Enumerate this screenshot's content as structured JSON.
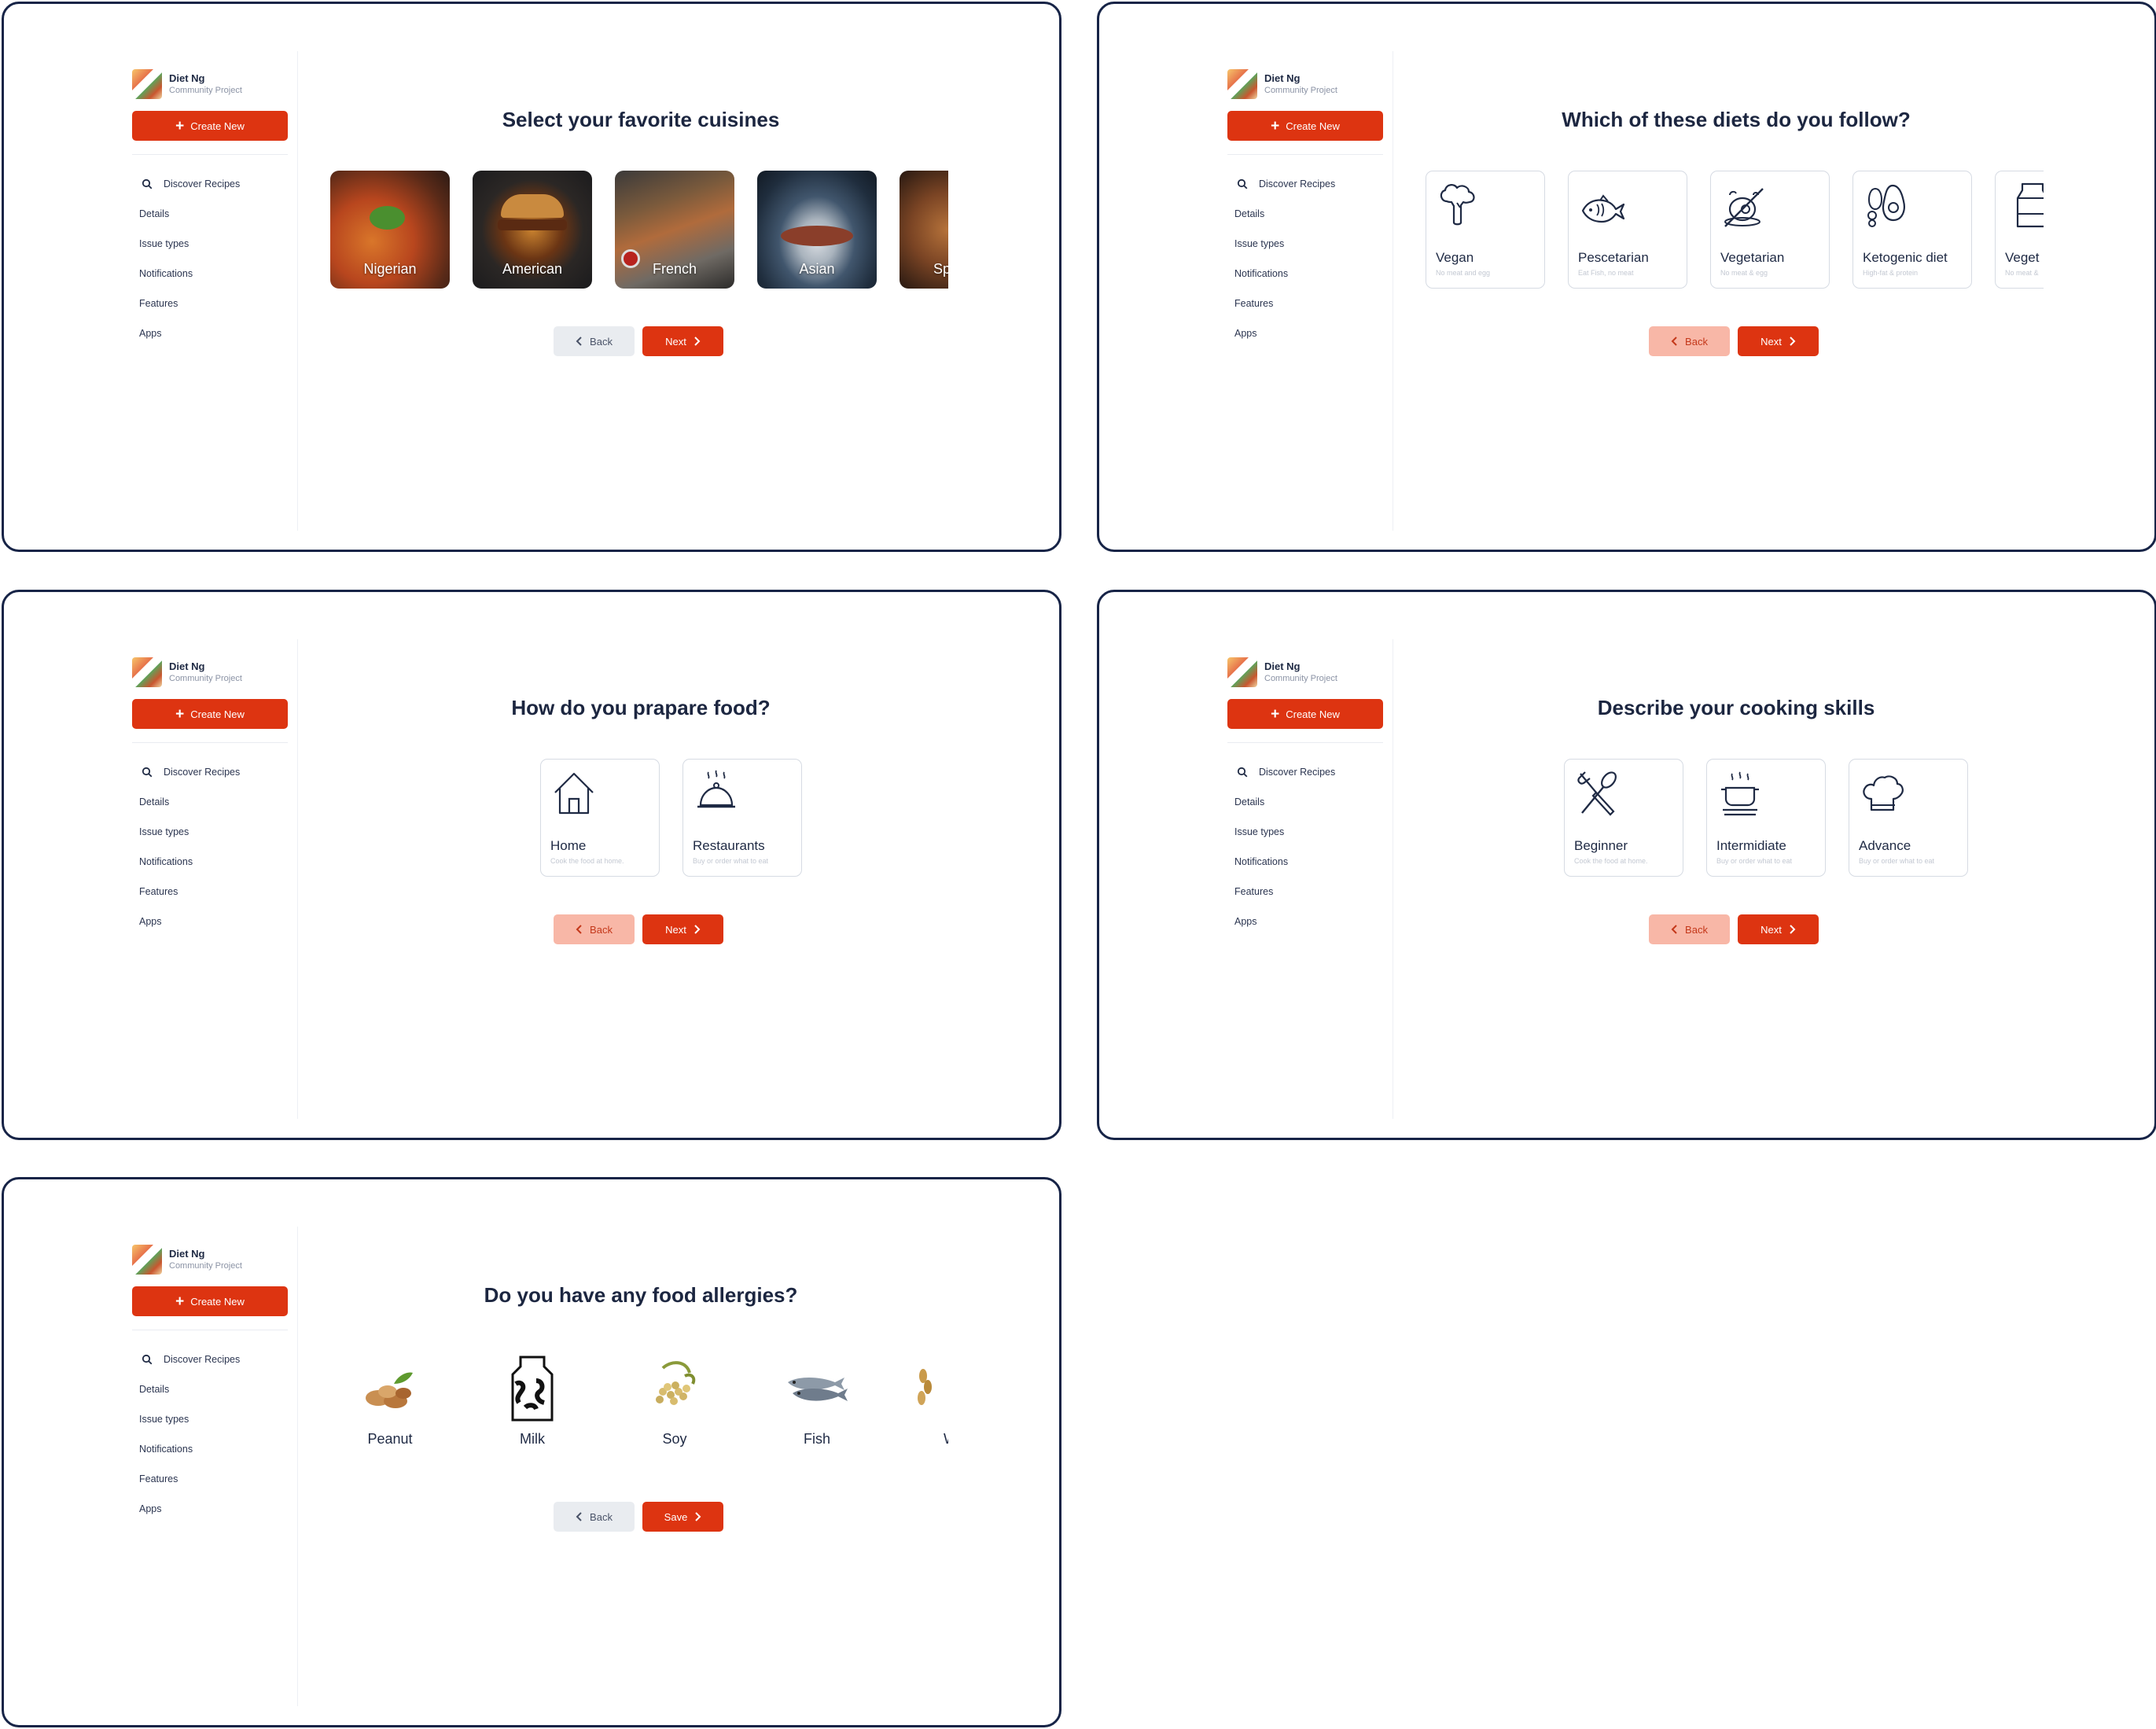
{
  "sidebar": {
    "brand_name": "Diet Ng",
    "brand_sub": "Community Project",
    "create_label": "Create New",
    "nav": [
      "Discover Recipes",
      "Details",
      "Issue types",
      "Notifications",
      "Features",
      "Apps"
    ]
  },
  "screens": [
    {
      "title": "Select your favorite cuisines",
      "items": [
        {
          "label": "Nigerian"
        },
        {
          "label": "American"
        },
        {
          "label": "French"
        },
        {
          "label": "Asian"
        },
        {
          "label": "Sp"
        }
      ],
      "back_label": "Back",
      "next_label": "Next"
    },
    {
      "title": "Which of these diets do you follow?",
      "items": [
        {
          "label": "Vegan",
          "desc": "No meat and egg"
        },
        {
          "label": "Pescetarian",
          "desc": "Eat Fish, no meat"
        },
        {
          "label": "Vegetarian",
          "desc": "No meat & egg"
        },
        {
          "label": "Ketogenic diet",
          "desc": "High-fat & protein"
        },
        {
          "label": "Veget",
          "desc": "No meat &"
        }
      ],
      "back_label": "Back",
      "next_label": "Next"
    },
    {
      "title": "How do you prapare food?",
      "items": [
        {
          "label": "Home",
          "desc": "Cook the food at home."
        },
        {
          "label": "Restaurants",
          "desc": "Buy or order what to eat"
        }
      ],
      "back_label": "Back",
      "next_label": "Next"
    },
    {
      "title": "Describe your cooking skills",
      "items": [
        {
          "label": "Beginner",
          "desc": "Cook the food at home."
        },
        {
          "label": "Intermidiate",
          "desc": "Buy or order what to eat"
        },
        {
          "label": "Advance",
          "desc": "Buy or order what to eat"
        }
      ],
      "back_label": "Back",
      "next_label": "Next"
    },
    {
      "title": "Do you have any food allergies?",
      "items": [
        {
          "label": "Peanut"
        },
        {
          "label": "Milk"
        },
        {
          "label": "Soy"
        },
        {
          "label": "Fish"
        },
        {
          "label": "W"
        }
      ],
      "back_label": "Back",
      "next_label": "Save"
    }
  ],
  "colors": {
    "accent": "#dd3411",
    "frame": "#172447",
    "back_disabled": "#e9ecf0",
    "back_pink": "#f8b7a7"
  },
  "icons": [
    "search-icon",
    "plus-icon",
    "chevron-left-icon",
    "chevron-right-icon",
    "broccoli-icon",
    "fish-icon",
    "no-meat-icon",
    "avocado-egg-icon",
    "milk-carton-icon",
    "house-icon",
    "cloche-icon",
    "fork-spoon-icon",
    "cooking-pot-icon",
    "chef-hat-icon"
  ]
}
